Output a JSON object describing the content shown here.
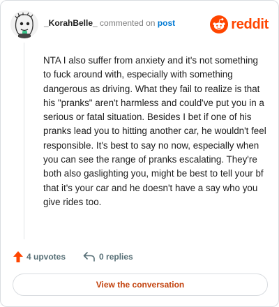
{
  "author": {
    "username": "_KorahBelle_",
    "action_text": "commented on",
    "target_link": "post"
  },
  "brand": {
    "wordmark": "reddit",
    "color": "#ff4500",
    "icon": "reddit-logo-icon"
  },
  "comment": {
    "body": "NTA I also suffer from anxiety and it's not something to fuck around with, especially with something dangerous as driving. What they fail to realize is that his \"pranks\" aren't harmless and could've put you in a serious or fatal situation. Besides I bet if one of his pranks lead you to hitting another car, he wouldn't feel responsible. It's best to say no now, especially when you can see the range of pranks escalating. They're both also gaslighting you, might be best to tell your bf that it's your car and he doesn't have a say who you give rides too."
  },
  "stats": {
    "upvotes_label": "4 upvotes",
    "replies_label": "0 replies",
    "upvote_icon": "upvote-arrow-icon",
    "reply_icon": "reply-arrow-icon",
    "upvote_color": "#ff4500"
  },
  "cta": {
    "label": "View the conversation",
    "color": "#c2410c"
  }
}
